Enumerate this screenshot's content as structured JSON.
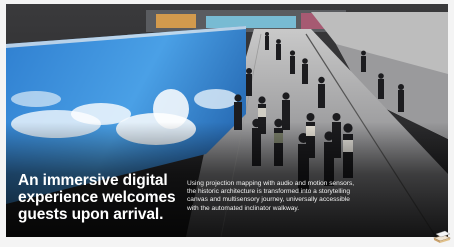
{
  "slide": {
    "headline": "An immersive digital experience welcomes guests upon arrival.",
    "description": "Using projection mapping with audio and motion sensors, the historic architecture is transformed into a storytelling canvas and multisensory journey, universally accessible with the automated inclinator walkway."
  },
  "colors": {
    "sky_blue": "#3a8fd8",
    "floor_gray": "#8a8a8e",
    "caption_text": "#ffffff"
  },
  "icons": {
    "corner_logo": "book-stack-icon"
  }
}
